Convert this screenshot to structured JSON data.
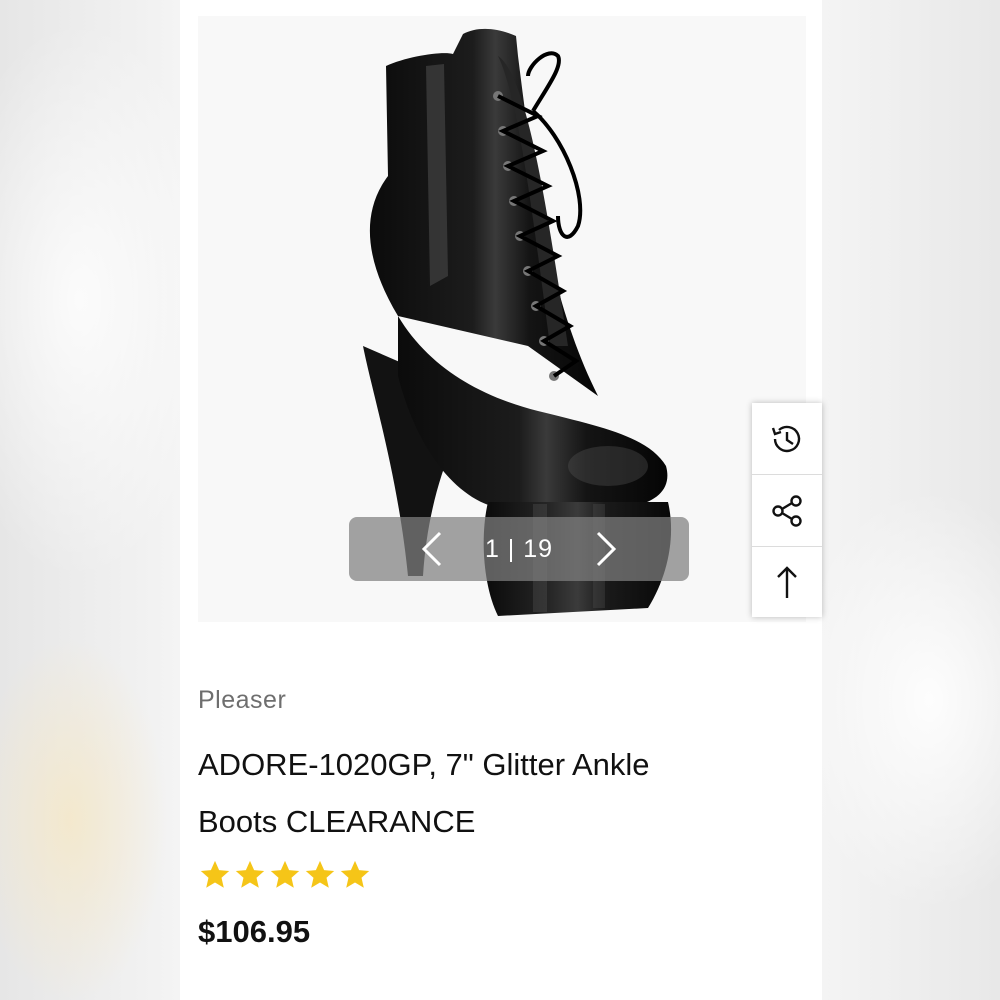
{
  "gallery": {
    "current": "1",
    "separator": "|",
    "total": "19",
    "prev_icon": "chevron-left-icon",
    "next_icon": "chevron-right-icon"
  },
  "side_tools": [
    {
      "icon": "history-icon"
    },
    {
      "icon": "share-icon"
    },
    {
      "icon": "arrow-up-icon"
    }
  ],
  "product": {
    "brand": "Pleaser",
    "title_line1": "ADORE-1020GP, 7\" Glitter Ankle",
    "title_line2": "Boots CLEARANCE",
    "rating": 5,
    "rating_max": 5,
    "price": "$106.95"
  },
  "colors": {
    "star": "#f5c518",
    "text": "#111111",
    "brand_text": "#6e6e6e"
  }
}
